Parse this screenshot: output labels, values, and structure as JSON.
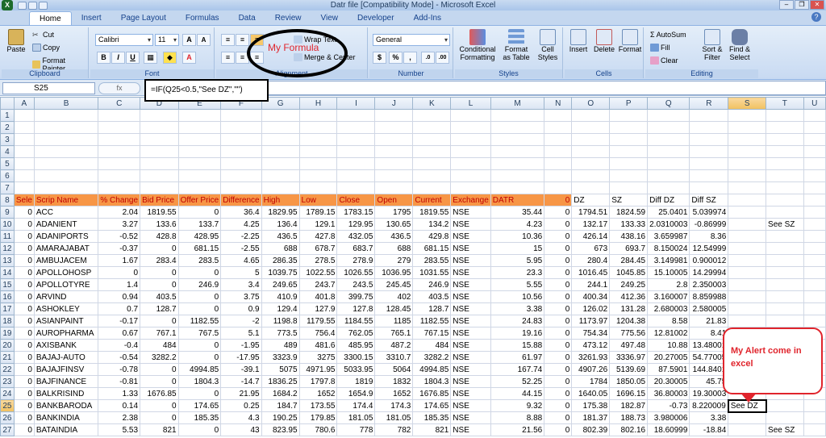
{
  "window": {
    "title": "Datr file  [Compatibility Mode] - Microsoft Excel",
    "orb": "X"
  },
  "tabs": [
    "Home",
    "Insert",
    "Page Layout",
    "Formulas",
    "Data",
    "Review",
    "View",
    "Developer",
    "Add-Ins"
  ],
  "ribbon": {
    "clipboard": {
      "label": "Clipboard",
      "paste": "Paste",
      "cut": "Cut",
      "copy": "Copy",
      "format_painter": "Format Painter"
    },
    "font": {
      "label": "Font",
      "name": "Calibri",
      "size": "11",
      "bold": "B",
      "italic": "I",
      "underline": "U"
    },
    "alignment": {
      "label": "Alignment",
      "wrap_text": "Wrap Text",
      "merge_center": "Merge & Center"
    },
    "number": {
      "label": "Number",
      "format": "General",
      "currency": "$",
      "percent": "%",
      "comma": ",",
      "inc_decimal": ".0",
      "dec_decimal": ".00"
    },
    "styles": {
      "label": "Styles",
      "conditional": "Conditional Formatting",
      "format_table": "Format as Table",
      "cell_styles": "Cell Styles"
    },
    "cells": {
      "label": "Cells",
      "insert": "Insert",
      "delete": "Delete",
      "format": "Format"
    },
    "editing": {
      "label": "Editing",
      "autosum": "AutoSum",
      "fill": "Fill",
      "clear": "Clear",
      "sort_filter": "Sort & Filter",
      "find_select": "Find & Select"
    }
  },
  "formula_bar": {
    "name_box": "S25",
    "fx": "fx",
    "formula": "=IF(Q25<0.5,\"See DZ\",\"\")"
  },
  "annotations": {
    "formula_label": "My Formula",
    "alert_label": "My Alert come in excel"
  },
  "columns": [
    "A",
    "B",
    "C",
    "D",
    "E",
    "F",
    "G",
    "H",
    "I",
    "J",
    "K",
    "L",
    "M",
    "N",
    "O",
    "P",
    "Q",
    "R",
    "S",
    "T",
    "U"
  ],
  "header_row": {
    "row": "8",
    "cells": [
      "Sele",
      "Scrip Name",
      "% Change",
      "Bid Price",
      "Offer Price",
      "Difference",
      "High",
      "Low",
      "Close",
      "Open",
      "Current",
      "Exchange",
      "DATR",
      "0",
      "DZ",
      "SZ",
      "Diff DZ",
      "Diff SZ",
      "",
      "",
      ""
    ]
  },
  "empty_rows": [
    "1",
    "2",
    "3",
    "4",
    "5",
    "6",
    "7"
  ],
  "rows": [
    {
      "n": "9",
      "c": [
        "0",
        "ACC",
        "2.04",
        "1819.55",
        "0",
        "36.4",
        "1829.95",
        "1789.15",
        "1783.15",
        "1795",
        "1819.55",
        "NSE",
        "35.44",
        "0",
        "1794.51",
        "1824.59",
        "25.0401",
        "5.039974",
        "",
        "",
        ""
      ]
    },
    {
      "n": "10",
      "c": [
        "0",
        "ADANIENT",
        "3.27",
        "133.6",
        "133.7",
        "4.25",
        "136.4",
        "129.1",
        "129.95",
        "130.65",
        "134.2",
        "NSE",
        "4.23",
        "0",
        "132.17",
        "133.33",
        "2.0310003",
        "-0.86999",
        "",
        "See SZ",
        ""
      ]
    },
    {
      "n": "11",
      "c": [
        "0",
        "ADANIPORTS",
        "-0.52",
        "428.8",
        "428.95",
        "-2.25",
        "436.5",
        "427.8",
        "432.05",
        "436.5",
        "429.8",
        "NSE",
        "10.36",
        "0",
        "426.14",
        "438.16",
        "3.659987",
        "8.36",
        "",
        "",
        ""
      ]
    },
    {
      "n": "12",
      "c": [
        "0",
        "AMARAJABAT",
        "-0.37",
        "0",
        "681.15",
        "-2.55",
        "688",
        "678.7",
        "683.7",
        "688",
        "681.15",
        "NSE",
        "15",
        "0",
        "673",
        "693.7",
        "8.150024",
        "12.54999",
        "",
        "",
        ""
      ]
    },
    {
      "n": "13",
      "c": [
        "0",
        "AMBUJACEM",
        "1.67",
        "283.4",
        "283.5",
        "4.65",
        "286.35",
        "278.5",
        "278.9",
        "279",
        "283.55",
        "NSE",
        "5.95",
        "0",
        "280.4",
        "284.45",
        "3.149981",
        "0.900012",
        "",
        "",
        ""
      ]
    },
    {
      "n": "14",
      "c": [
        "0",
        "APOLLOHOSP",
        "0",
        "0",
        "0",
        "5",
        "1039.75",
        "1022.55",
        "1026.55",
        "1036.95",
        "1031.55",
        "NSE",
        "23.3",
        "0",
        "1016.45",
        "1045.85",
        "15.10005",
        "14.29994",
        "",
        "",
        ""
      ]
    },
    {
      "n": "15",
      "c": [
        "0",
        "APOLLOTYRE",
        "1.4",
        "0",
        "246.9",
        "3.4",
        "249.65",
        "243.7",
        "243.5",
        "245.45",
        "246.9",
        "NSE",
        "5.55",
        "0",
        "244.1",
        "249.25",
        "2.8",
        "2.350003",
        "",
        "",
        ""
      ]
    },
    {
      "n": "16",
      "c": [
        "0",
        "ARVIND",
        "0.94",
        "403.5",
        "0",
        "3.75",
        "410.9",
        "401.8",
        "399.75",
        "402",
        "403.5",
        "NSE",
        "10.56",
        "0",
        "400.34",
        "412.36",
        "3.160007",
        "8.859988",
        "",
        "",
        ""
      ]
    },
    {
      "n": "17",
      "c": [
        "0",
        "ASHOKLEY",
        "0.7",
        "128.7",
        "0",
        "0.9",
        "129.4",
        "127.9",
        "127.8",
        "128.45",
        "128.7",
        "NSE",
        "3.38",
        "0",
        "126.02",
        "131.28",
        "2.680003",
        "2.580005",
        "",
        "",
        ""
      ]
    },
    {
      "n": "18",
      "c": [
        "0",
        "ASIANPAINT",
        "-0.17",
        "0",
        "1182.55",
        "-2",
        "1198.8",
        "1179.55",
        "1184.55",
        "1185",
        "1182.55",
        "NSE",
        "24.83",
        "0",
        "1173.97",
        "1204.38",
        "8.58",
        "21.83",
        "",
        "",
        ""
      ]
    },
    {
      "n": "19",
      "c": [
        "0",
        "AUROPHARMA",
        "0.67",
        "767.1",
        "767.5",
        "5.1",
        "773.5",
        "756.4",
        "762.05",
        "765.1",
        "767.15",
        "NSE",
        "19.16",
        "0",
        "754.34",
        "775.56",
        "12.81002",
        "8.41",
        "",
        "",
        ""
      ]
    },
    {
      "n": "20",
      "c": [
        "0",
        "AXISBANK",
        "-0.4",
        "484",
        "0",
        "-1.95",
        "489",
        "481.6",
        "485.95",
        "487.2",
        "484",
        "NSE",
        "15.88",
        "0",
        "473.12",
        "497.48",
        "10.88",
        "13.48001",
        "",
        "",
        ""
      ]
    },
    {
      "n": "21",
      "c": [
        "0",
        "BAJAJ-AUTO",
        "-0.54",
        "3282.2",
        "0",
        "-17.95",
        "3323.9",
        "3275",
        "3300.15",
        "3310.7",
        "3282.2",
        "NSE",
        "61.97",
        "0",
        "3261.93",
        "3336.97",
        "20.27005",
        "54.77005",
        "",
        "",
        ""
      ]
    },
    {
      "n": "22",
      "c": [
        "0",
        "BAJAJFINSV",
        "-0.78",
        "0",
        "4994.85",
        "-39.1",
        "5075",
        "4971.95",
        "5033.95",
        "5064",
        "4994.85",
        "NSE",
        "167.74",
        "0",
        "4907.26",
        "5139.69",
        "87.5901",
        "144.8401",
        "",
        "",
        ""
      ]
    },
    {
      "n": "23",
      "c": [
        "0",
        "BAJFINANCE",
        "-0.81",
        "0",
        "1804.3",
        "-14.7",
        "1836.25",
        "1797.8",
        "1819",
        "1832",
        "1804.3",
        "NSE",
        "52.25",
        "0",
        "1784",
        "1850.05",
        "20.30005",
        "45.75",
        "",
        "",
        ""
      ]
    },
    {
      "n": "24",
      "c": [
        "0",
        "BALKRISIND",
        "1.33",
        "1676.85",
        "0",
        "21.95",
        "1684.2",
        "1652",
        "1654.9",
        "1652",
        "1676.85",
        "NSE",
        "44.15",
        "0",
        "1640.05",
        "1696.15",
        "36.80003",
        "19.30003",
        "",
        "",
        ""
      ]
    },
    {
      "n": "25",
      "c": [
        "0",
        "BANKBARODA",
        "0.14",
        "0",
        "174.65",
        "0.25",
        "184.7",
        "173.55",
        "174.4",
        "174.3",
        "174.65",
        "NSE",
        "9.32",
        "0",
        "175.38",
        "182.87",
        "-0.73",
        "8.220009",
        "See DZ",
        "",
        ""
      ]
    },
    {
      "n": "26",
      "c": [
        "0",
        "BANKINDIA",
        "2.38",
        "0",
        "185.35",
        "4.3",
        "190.25",
        "179.85",
        "181.05",
        "181.05",
        "185.35",
        "NSE",
        "8.88",
        "0",
        "181.37",
        "188.73",
        "3.980006",
        "3.38",
        "",
        "",
        ""
      ]
    },
    {
      "n": "27",
      "c": [
        "0",
        "BATAINDIA",
        "5.53",
        "821",
        "0",
        "43",
        "823.95",
        "780.6",
        "778",
        "782",
        "821",
        "NSE",
        "21.56",
        "0",
        "802.39",
        "802.16",
        "18.60999",
        "-18.84",
        "",
        "See SZ",
        ""
      ]
    }
  ],
  "colors": {
    "header_fill": "#f79646",
    "header_text": "#c00000",
    "annotation_red": "#e0242c"
  }
}
